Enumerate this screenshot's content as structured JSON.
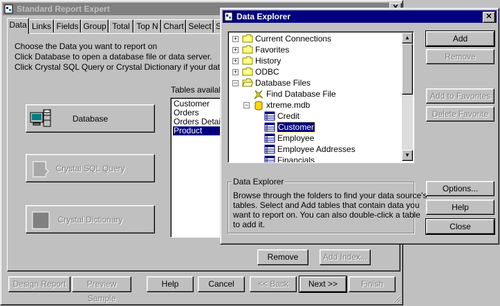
{
  "report_expert": {
    "title": "Standard Report Expert",
    "close_label": "✕",
    "tabs": [
      "Data",
      "Links",
      "Fields",
      "Group",
      "Total",
      "Top N",
      "Chart",
      "Select",
      "S"
    ],
    "instructions": [
      "Choose the Data you want to report on",
      "Click Database to open a database file or data server.",
      "Click Crystal SQL Query or Crystal Dictionary if your data is alrea"
    ],
    "database_label": "Database",
    "sql_query_label": "Crystal SQL Query",
    "dictionary_label": "Crystal Dictionary",
    "tables_label": "Tables availabl",
    "tables": [
      "Customer",
      "Orders",
      "Orders Detail",
      "Product"
    ],
    "selected_table": "Product",
    "remove_label": "Remove",
    "add_index_label": "Add Index...",
    "footer": {
      "design_report": "Design Report",
      "preview_sample": "Preview Sample",
      "help": "Help",
      "cancel": "Cancel",
      "back": "<< Back",
      "next": "Next >>",
      "finish": "Finish"
    }
  },
  "data_explorer": {
    "title": "Data Explorer",
    "close_label": "✕",
    "tree": [
      {
        "label": "Current Connections",
        "level": 0,
        "expander": "+",
        "icon": "folder-icon"
      },
      {
        "label": "Favorites",
        "level": 0,
        "expander": "+",
        "icon": "folder-icon"
      },
      {
        "label": "History",
        "level": 0,
        "expander": "+",
        "icon": "folder-icon"
      },
      {
        "label": "ODBC",
        "level": 0,
        "expander": "+",
        "icon": "folder-icon"
      },
      {
        "label": "Database Files",
        "level": 0,
        "expander": "−",
        "icon": "folder-open-icon"
      },
      {
        "label": "Find Database File",
        "level": 1,
        "expander": "",
        "icon": "find-file-icon"
      },
      {
        "label": "xtreme.mdb",
        "level": 1,
        "expander": "−",
        "icon": "database-icon"
      },
      {
        "label": "Credit",
        "level": 2,
        "expander": "",
        "icon": "table-icon"
      },
      {
        "label": "Customer",
        "level": 2,
        "expander": "",
        "icon": "table-icon",
        "selected": true
      },
      {
        "label": "Employee",
        "level": 2,
        "expander": "",
        "icon": "table-icon"
      },
      {
        "label": "Employee Addresses",
        "level": 2,
        "expander": "",
        "icon": "table-icon"
      },
      {
        "label": "Financials",
        "level": 2,
        "expander": "",
        "icon": "table-icon"
      }
    ],
    "description_title": "Data Explorer",
    "description_lines": [
      "Browse through the folders to find your data source's",
      "tables.  Select and Add tables that contain data you",
      "want to report on.  You can also double-click a table",
      "to add it."
    ],
    "buttons": {
      "add": "Add",
      "remove": "Remove",
      "add_to_favorites": "Add to Favorites",
      "delete_favorite": "Delete Favorite",
      "options": "Options...",
      "help": "Help",
      "close": "Close"
    }
  }
}
